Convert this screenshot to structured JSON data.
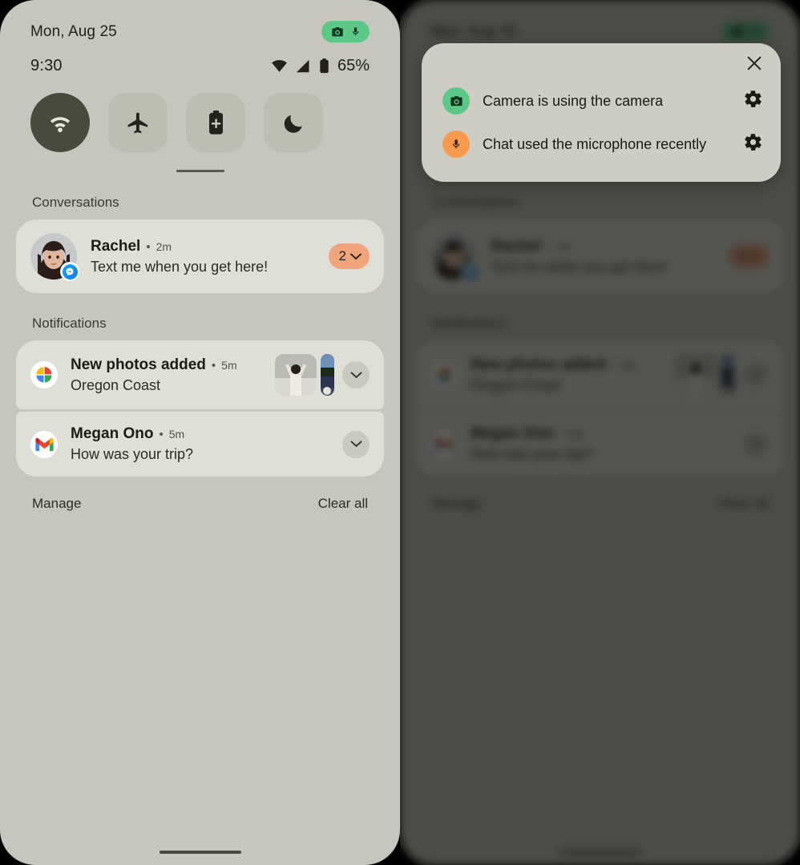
{
  "status_bar": {
    "date": "Mon, Aug 25",
    "time": "9:30",
    "battery_percent": "65%",
    "privacy_indicators": [
      "camera-icon",
      "microphone-icon"
    ],
    "signal_icons": [
      "wifi-icon",
      "cellular-signal-icon",
      "battery-icon"
    ],
    "privacy_pill_color": "#5bc888"
  },
  "quick_settings": {
    "tiles": [
      {
        "name": "wifi",
        "icon": "wifi-icon",
        "active": true
      },
      {
        "name": "airplane-mode",
        "icon": "airplane-icon",
        "active": false
      },
      {
        "name": "battery-saver",
        "icon": "battery-saver-icon",
        "active": false
      },
      {
        "name": "do-not-disturb",
        "icon": "moon-icon",
        "active": false
      }
    ],
    "active_tile_color": "#4a4a3c",
    "inactive_tile_color": "#bdbdb2"
  },
  "conversations": {
    "header": "Conversations",
    "items": [
      {
        "sender": "Rachel",
        "separator": "•",
        "time": "2m",
        "message": "Text me when you get here!",
        "badge_count": "2",
        "app_badge": "messenger-icon",
        "badge_color": "#efa47c"
      }
    ]
  },
  "notifications": {
    "header": "Notifications",
    "items": [
      {
        "app": "google-photos-icon",
        "title": "New photos added",
        "separator": "•",
        "time": "5m",
        "body": "Oregon Coast",
        "has_thumbnails": true,
        "expand": "chevron-down-icon"
      },
      {
        "app": "gmail-icon",
        "title": "Megan Ono",
        "separator": "•",
        "time": "5m",
        "body": "How was your trip?",
        "has_thumbnails": false,
        "expand": "chevron-down-icon"
      }
    ]
  },
  "footer": {
    "manage_label": "Manage",
    "clear_all_label": "Clear all"
  },
  "privacy_dialog": {
    "close_icon": "close-icon",
    "rows": [
      {
        "icon": "camera-icon",
        "icon_color": "#5bc888",
        "label": "Camera is using the camera",
        "settings_icon": "gear-icon"
      },
      {
        "icon": "microphone-icon",
        "icon_color": "#f79a4e",
        "label": "Chat used the microphone recently",
        "settings_icon": "gear-icon"
      }
    ]
  },
  "theme": {
    "background": "#c6c6bf",
    "card": "#dedfd6",
    "dialog": "#cdcdc4",
    "text_primary": "#1d1c16",
    "text_secondary": "#55544c"
  }
}
